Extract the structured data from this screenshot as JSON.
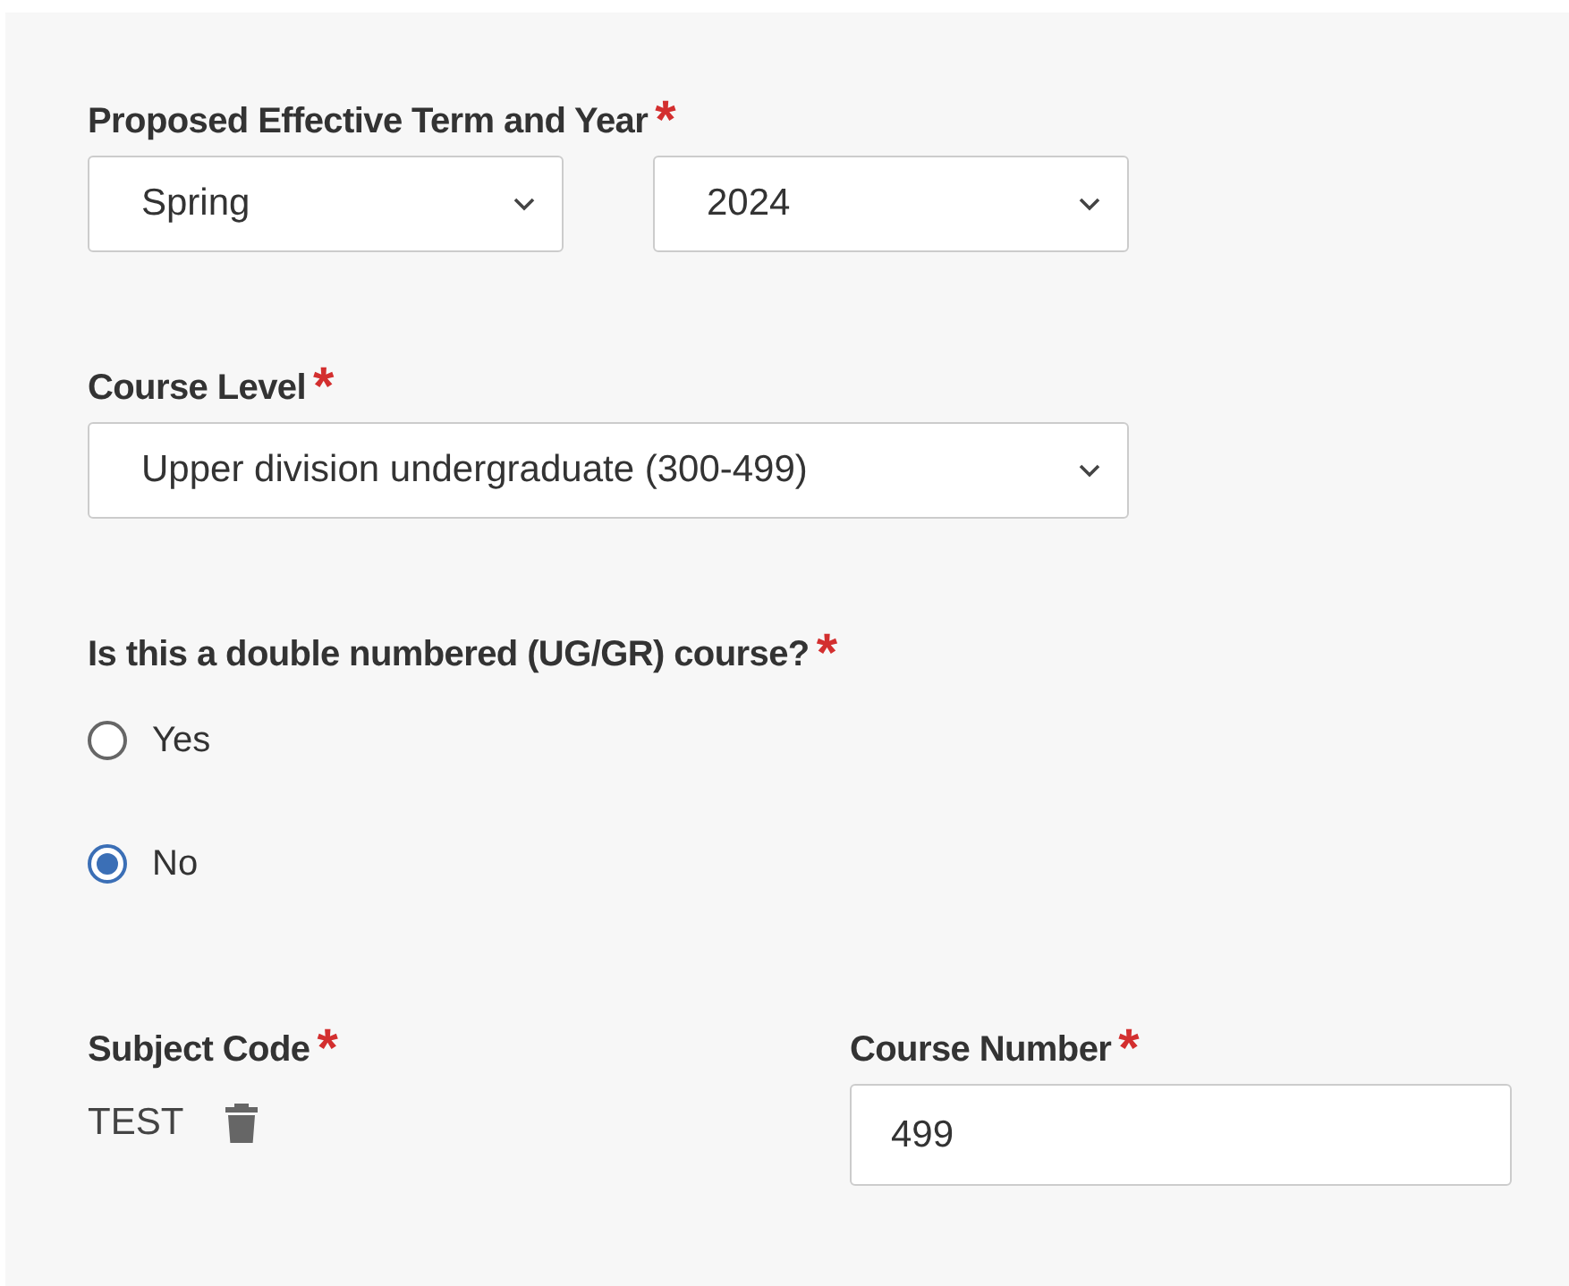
{
  "term_year": {
    "label": "Proposed Effective Term and Year",
    "required_mark": "*",
    "selects": [
      {
        "value": "Spring"
      },
      {
        "value": "2024"
      }
    ]
  },
  "course_level": {
    "label": "Course Level",
    "required_mark": "*",
    "value": "Upper division undergraduate (300-499)"
  },
  "double_numbered": {
    "label": "Is this a double numbered (UG/GR) course?",
    "required_mark": "*",
    "options": [
      {
        "label": "Yes",
        "selected": false
      },
      {
        "label": "No",
        "selected": true
      }
    ]
  },
  "subject_code": {
    "label": "Subject Code",
    "required_mark": "*",
    "value": "TEST"
  },
  "course_number": {
    "label": "Course Number",
    "required_mark": "*",
    "value": "499"
  }
}
